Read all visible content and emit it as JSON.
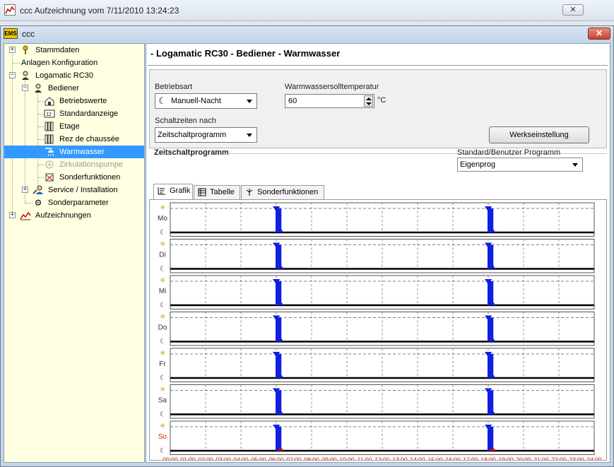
{
  "outer_window": {
    "title": "ccc Aufzeichnung vom 7/11/2010 13:24:23",
    "close_label": "✕"
  },
  "child_window": {
    "logo": "EMS",
    "title": "ccc",
    "close_label": "✕"
  },
  "tree": {
    "items": [
      {
        "label": "Stammdaten",
        "icon": "key-icon"
      },
      {
        "label": "Anlagen Konfiguration",
        "icon": ""
      },
      {
        "label": "Logamatic RC30",
        "icon": "person-icon"
      },
      {
        "label": "Bediener",
        "icon": "person-icon"
      },
      {
        "label": "Betriebswerte",
        "icon": "house-icon"
      },
      {
        "label": "Standardanzeige",
        "icon": "display-icon"
      },
      {
        "label": "Etage",
        "icon": "radiator-icon"
      },
      {
        "label": "Rez de chaussée",
        "icon": "radiator-icon"
      },
      {
        "label": "Warmwasser",
        "icon": "shower-icon"
      },
      {
        "label": "Zirkulationspumpe",
        "icon": "pump-icon"
      },
      {
        "label": "Sonderfunktionen",
        "icon": "flag-icon"
      },
      {
        "label": "Service / Installation",
        "icon": "tools-icon"
      },
      {
        "label": "Sonderparameter",
        "icon": "gear-icon"
      },
      {
        "label": "Aufzeichnungen",
        "icon": "chart-icon"
      }
    ]
  },
  "main": {
    "title": "- Logamatic RC30 - Bediener - Warmwasser",
    "betriebsart_label": "Betriebsart",
    "betriebsart_value": "Manuell-Nacht",
    "temp_label": "Warmwassersolltemperatur",
    "temp_value": "60",
    "temp_unit": "°C",
    "schaltzeiten_label": "Schaltzeiten nach",
    "schaltzeiten_value": "Zeitschaltprogramm",
    "werkseinstellung_label": "Werkseinstellung",
    "section_title": "Zeitschaltprogramm",
    "program_label": "Standard/Benutzer Programm",
    "program_value": "Eigenprog",
    "tabs": [
      "Grafik",
      "Tabelle",
      "Sonderfunktionen"
    ]
  },
  "schedule": {
    "days": [
      "Mo",
      "Di",
      "Mi",
      "Do",
      "Fr",
      "Sa",
      "So"
    ],
    "switch_points": [
      {
        "on": "06:00",
        "off": "06:15"
      },
      {
        "on": "18:00",
        "off": "18:15"
      }
    ],
    "time_axis": [
      "00:00",
      "01:00",
      "02:00",
      "03:00",
      "04:00",
      "05:00",
      "06:00",
      "07:00",
      "08:00",
      "09:00",
      "10:00",
      "11:00",
      "12:00",
      "13:00",
      "14:00",
      "15:00",
      "16:00",
      "17:00",
      "18:00",
      "19:00",
      "20:00",
      "21:00",
      "22:00",
      "23:00",
      "24:00"
    ],
    "colors": {
      "bar": "#1020e0",
      "axis_text": "#d11111",
      "sunday_label": "#e02010"
    }
  }
}
